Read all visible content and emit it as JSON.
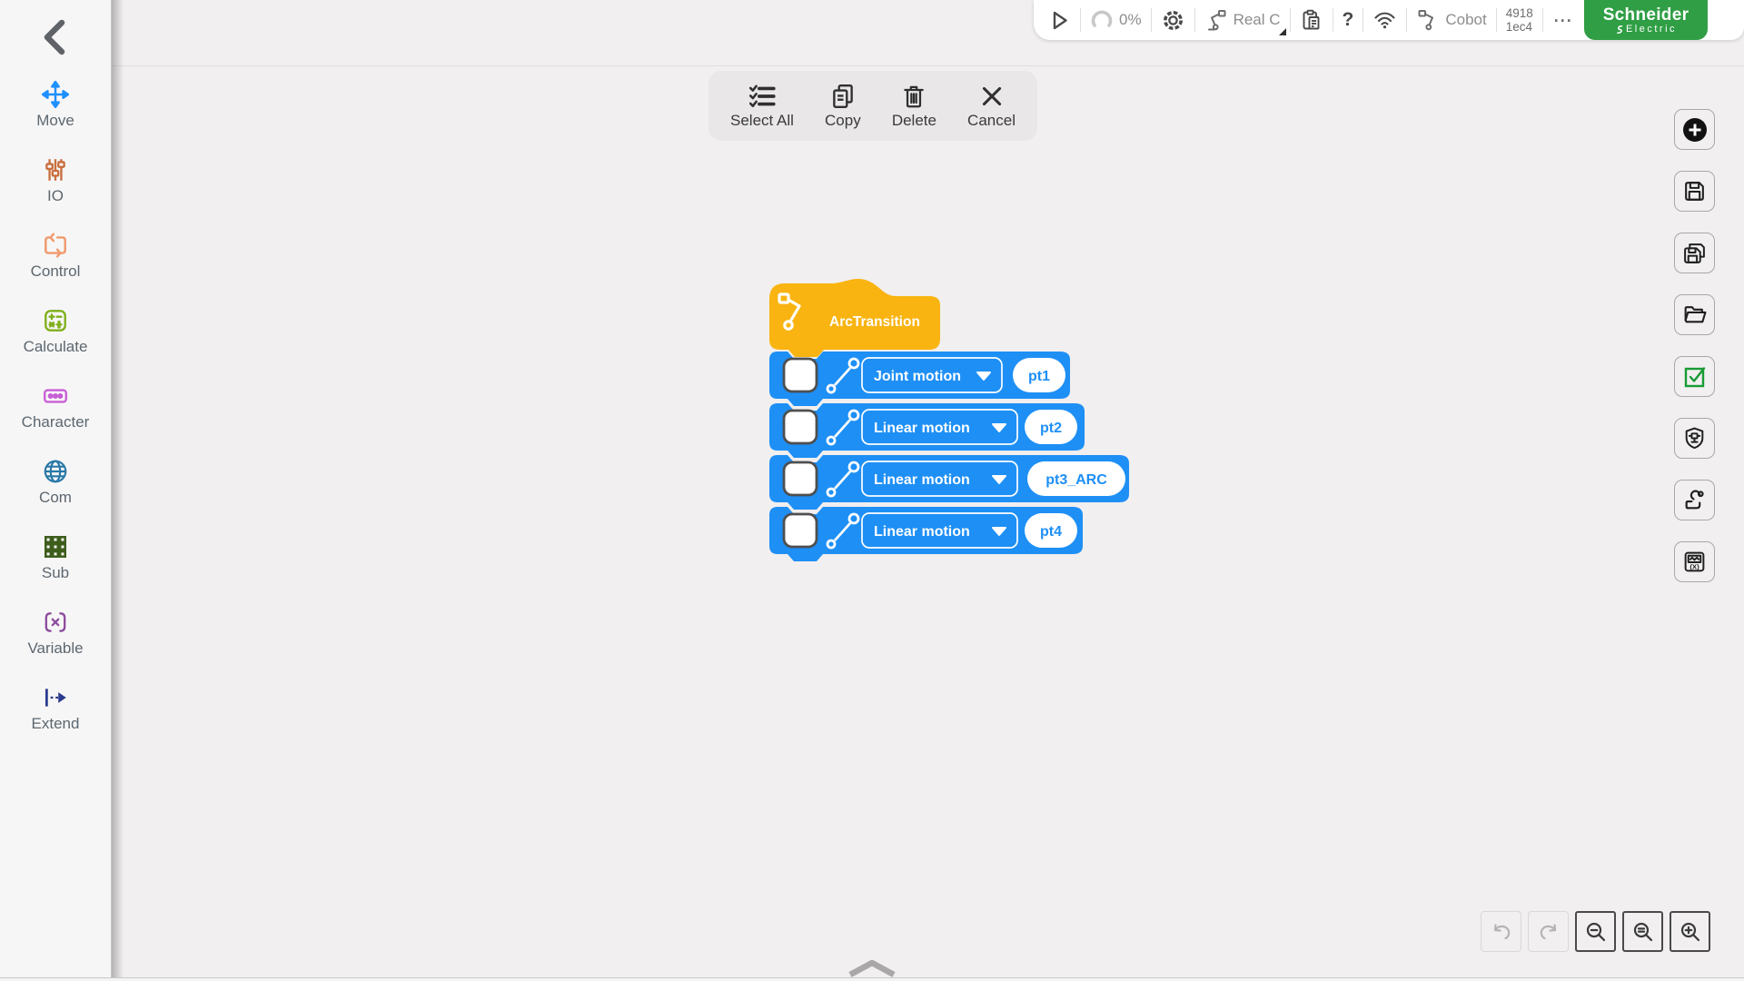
{
  "sidebar": {
    "items": [
      {
        "label": "Move",
        "color": "#1E90FF"
      },
      {
        "label": "IO",
        "color": "#C96F3F"
      },
      {
        "label": "Control",
        "color": "#F09A6E"
      },
      {
        "label": "Calculate",
        "color": "#7FAF1B"
      },
      {
        "label": "Character",
        "color": "#C75FD6"
      },
      {
        "label": "Com",
        "color": "#2878A8"
      },
      {
        "label": "Sub",
        "color": "#3E5D1C"
      },
      {
        "label": "Variable",
        "color": "#8E4D9E"
      },
      {
        "label": "Extend",
        "color": "#2B3C8F"
      }
    ]
  },
  "selection_toolbar": {
    "items": [
      {
        "label": "Select All"
      },
      {
        "label": "Copy"
      },
      {
        "label": "Delete"
      },
      {
        "label": "Cancel"
      }
    ]
  },
  "status_bar": {
    "progress": "0%",
    "mode_label": "Real C",
    "help_label": "?",
    "robot_label": "Cobot",
    "device_id_line1": "4918",
    "device_id_line2": "1ec4",
    "more_label": "...",
    "brand": {
      "line1": "Schneider",
      "line2": "Electric",
      "color": "#2F9E44"
    }
  },
  "workspace": {
    "hat_block": {
      "label": "ArcTransition",
      "color": "#F9B411"
    },
    "block_color": "#1E8FF5",
    "rows": [
      {
        "motion": "Joint motion",
        "point": "pt1"
      },
      {
        "motion": "Linear motion",
        "point": "pt2"
      },
      {
        "motion": "Linear motion",
        "point": "pt3_ARC"
      },
      {
        "motion": "Linear motion",
        "point": "pt4"
      }
    ]
  }
}
